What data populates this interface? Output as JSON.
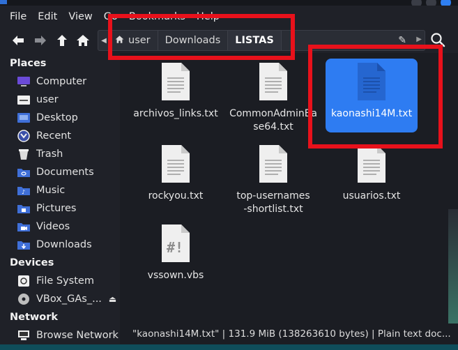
{
  "menu": [
    "File",
    "Edit",
    "View",
    "Go",
    "Bookmarks",
    "Help"
  ],
  "breadcrumbs": [
    "user",
    "Downloads",
    "LISTAS"
  ],
  "sidebar": {
    "places_title": "Places",
    "places": [
      {
        "label": "Computer",
        "icon": "computer-icon"
      },
      {
        "label": "user",
        "icon": "home-folder-icon"
      },
      {
        "label": "Desktop",
        "icon": "desktop-icon"
      },
      {
        "label": "Recent",
        "icon": "recent-icon"
      },
      {
        "label": "Trash",
        "icon": "trash-icon"
      },
      {
        "label": "Documents",
        "icon": "documents-folder-icon"
      },
      {
        "label": "Music",
        "icon": "music-folder-icon"
      },
      {
        "label": "Pictures",
        "icon": "pictures-folder-icon"
      },
      {
        "label": "Videos",
        "icon": "videos-folder-icon"
      },
      {
        "label": "Downloads",
        "icon": "downloads-folder-icon"
      }
    ],
    "devices_title": "Devices",
    "devices": [
      {
        "label": "File System",
        "icon": "drive-icon"
      },
      {
        "label": "VBox_GAs_...",
        "icon": "optical-disc-icon"
      }
    ],
    "network_title": "Network",
    "network": [
      {
        "label": "Browse Network",
        "icon": "network-icon"
      }
    ]
  },
  "files": [
    {
      "name": "archivos_links.txt",
      "type": "text",
      "selected": false
    },
    {
      "name": "CommonAdminBase64.txt",
      "type": "text",
      "selected": false
    },
    {
      "name": "kaonashi14M.txt",
      "type": "text",
      "selected": true
    },
    {
      "name": "rockyou.txt",
      "type": "text",
      "selected": false
    },
    {
      "name": "top-usernames-shortlist.txt",
      "type": "text",
      "selected": false
    },
    {
      "name": "usuarios.txt",
      "type": "text",
      "selected": false
    },
    {
      "name": "vssown.vbs",
      "type": "script",
      "selected": false
    }
  ],
  "status": "\"kaonashi14M.txt\" | 131.9 MiB (138263610 bytes) | Plain text doc...",
  "colors": {
    "accent": "#2e7cf2",
    "highlight": "#e8111b",
    "folder": "#3f6fd8"
  }
}
